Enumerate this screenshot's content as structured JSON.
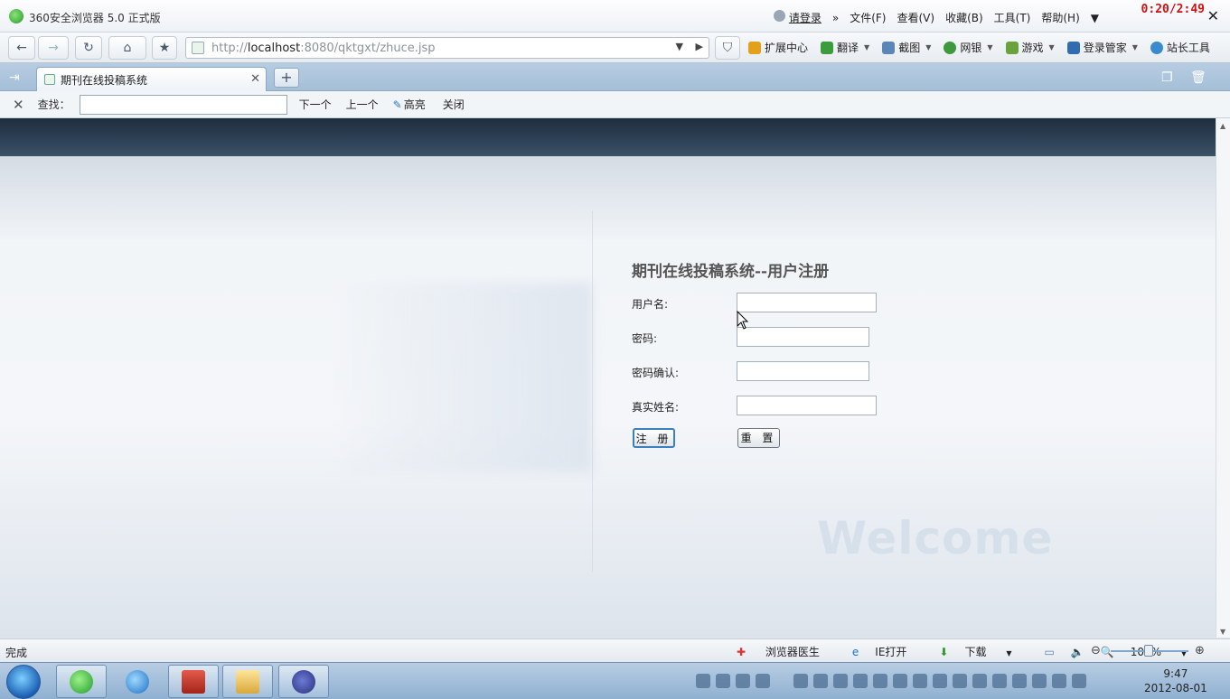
{
  "window": {
    "title": "360安全浏览器 5.0 正式版",
    "login_link": "请登录",
    "menu": [
      "文件(F)",
      "查看(V)",
      "收藏(B)",
      "工具(T)",
      "帮助(H)"
    ],
    "timer": "0:20/2:49",
    "close_glyph": "✕"
  },
  "nav": {
    "url_prefix": "http://",
    "url_host": "localhost",
    "url_rest": ":8080/qktgxt/zhuce.jsp",
    "tools": [
      {
        "label": "扩展中心",
        "icon": "extension-icon",
        "color": "#e3a11b",
        "dropdown": false
      },
      {
        "label": "翻译",
        "icon": "translate-icon",
        "color": "#3b9c3b",
        "dropdown": true
      },
      {
        "label": "截图",
        "icon": "screenshot-icon",
        "color": "#5a86b8",
        "dropdown": true
      },
      {
        "label": "网银",
        "icon": "bank-icon",
        "color": "#3c9a3c",
        "dropdown": true
      },
      {
        "label": "游戏",
        "icon": "game-icon",
        "color": "#6aa33a",
        "dropdown": true
      },
      {
        "label": "登录管家",
        "icon": "key-icon",
        "color": "#2f6db0",
        "dropdown": true
      },
      {
        "label": "站长工具",
        "icon": "webmaster-icon",
        "color": "#3b8ad0",
        "dropdown": false
      }
    ]
  },
  "tab": {
    "title": "期刊在线投稿系统"
  },
  "findbar": {
    "label": "查找：",
    "value": "",
    "next": "下一个",
    "prev": "上一个",
    "highlight": "高亮",
    "close": "关闭"
  },
  "form": {
    "title": "期刊在线投稿系统--用户注册",
    "fields": [
      {
        "label": "用户名:",
        "value": ""
      },
      {
        "label": "密码:",
        "value": ""
      },
      {
        "label": "密码确认:",
        "value": ""
      },
      {
        "label": "真实姓名:",
        "value": ""
      }
    ],
    "submit": "注 册",
    "reset": "重 置"
  },
  "page": {
    "welcome": "Welcome"
  },
  "status": {
    "text": "完成",
    "doctor": "浏览器医生",
    "ie_open": "IE打开",
    "download": "下载",
    "zoom": "100%"
  },
  "taskbar": {
    "time": "9:47",
    "date": "2012-08-01"
  }
}
